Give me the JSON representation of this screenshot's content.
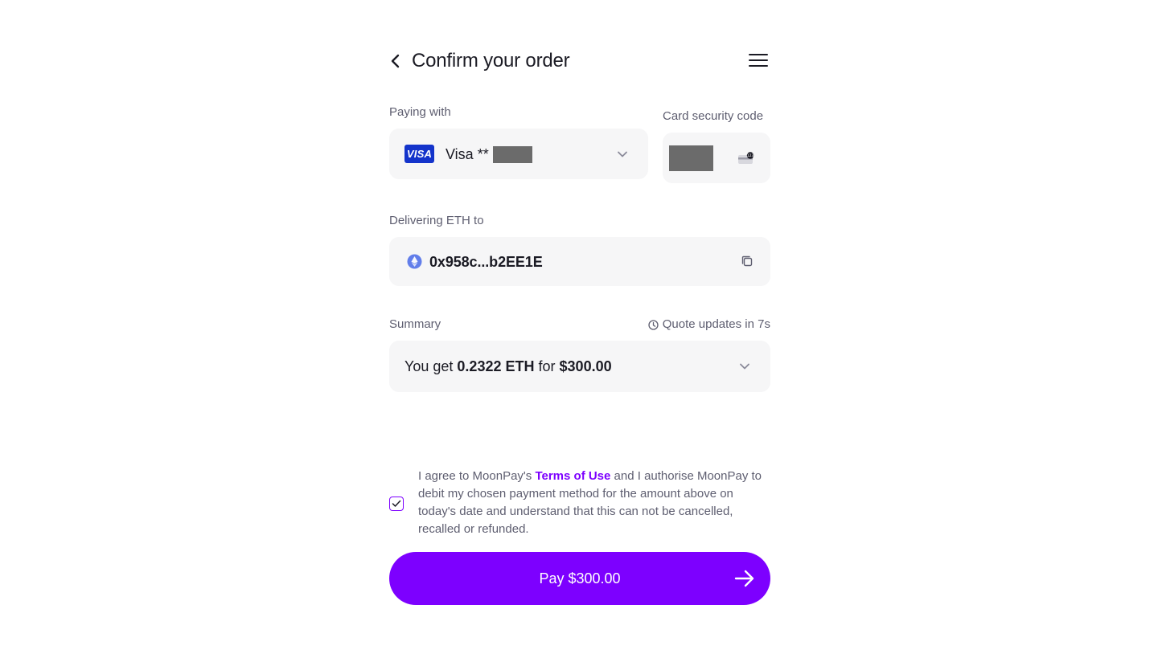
{
  "header": {
    "title": "Confirm your order",
    "back_icon": "chevron-left-icon",
    "menu_icon": "hamburger-menu-icon"
  },
  "payment": {
    "label": "Paying with",
    "card_brand": "VISA",
    "card_text": "Visa **",
    "card_icon": "visa-logo-icon"
  },
  "security": {
    "label": "Card security code",
    "icon": "card-cvc-icon"
  },
  "delivery": {
    "label": "Delivering ETH to",
    "address": "0x958c...b2EE1E",
    "coin_icon": "ethereum-icon",
    "copy_icon": "copy-icon"
  },
  "summary": {
    "label": "Summary",
    "quote_text": "Quote updates in 7s",
    "you_get": "You get",
    "amount": "0.2322 ETH",
    "for": "for",
    "price": "$300.00"
  },
  "agreement": {
    "checked": true,
    "text_before": "I agree to MoonPay's",
    "link_text": "Terms of Use",
    "text_after": "and I authorise MoonPay to debit my chosen payment method for the amount above on today's date and understand that this can not be cancelled, recalled or refunded."
  },
  "pay_button": {
    "label": "Pay $300.00"
  },
  "colors": {
    "accent": "#7d00ff",
    "field_bg": "#f6f6f7",
    "muted_text": "#5e5e70",
    "visa_blue": "#1434cb",
    "eth_blue": "#627eea"
  }
}
